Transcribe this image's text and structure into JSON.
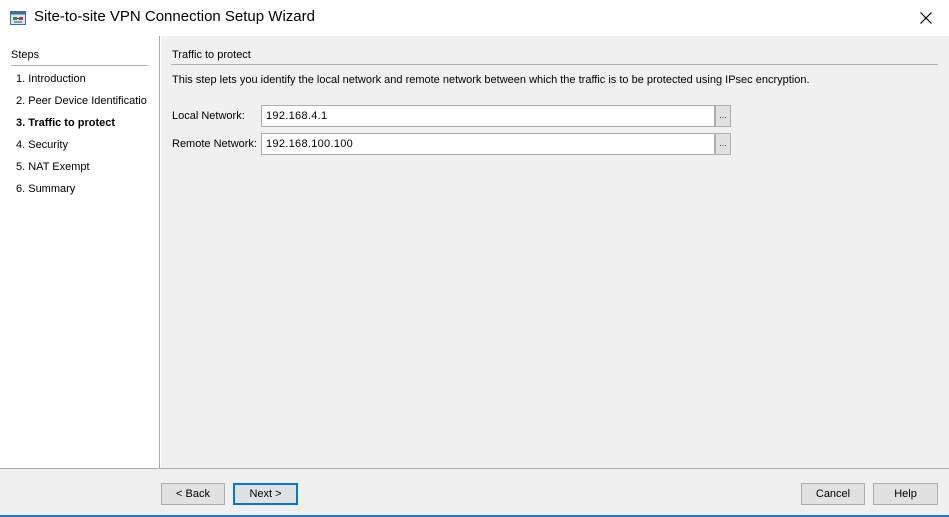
{
  "window": {
    "title": "Site-to-site VPN Connection Setup Wizard",
    "icon": "network-icon",
    "close_glyph": "✕"
  },
  "sidebar": {
    "header": "Steps",
    "items": [
      {
        "label": "1.  Introduction",
        "active": false
      },
      {
        "label": "2.  Peer Device Identificatio",
        "active": false
      },
      {
        "label": "3.  Traffic to protect",
        "active": true
      },
      {
        "label": "4.  Security",
        "active": false
      },
      {
        "label": "5.  NAT Exempt",
        "active": false
      },
      {
        "label": "6.  Summary",
        "active": false
      }
    ]
  },
  "main": {
    "section_title": "Traffic to protect",
    "description": "This step lets you identify the local network and remote network between which the traffic is to be protected using IPsec encryption.",
    "local_network": {
      "label": "Local Network:",
      "value": "192.168.4.1",
      "browse": "..."
    },
    "remote_network": {
      "label": "Remote Network:",
      "value": "192.168.100.100",
      "browse": "..."
    }
  },
  "footer": {
    "back": "< Back",
    "next": "Next >",
    "cancel": "Cancel",
    "help": "Help"
  },
  "colors": {
    "accent": "#0078d7",
    "bottom_line": "#1979ca",
    "panel_bg": "#f0f0f0"
  }
}
